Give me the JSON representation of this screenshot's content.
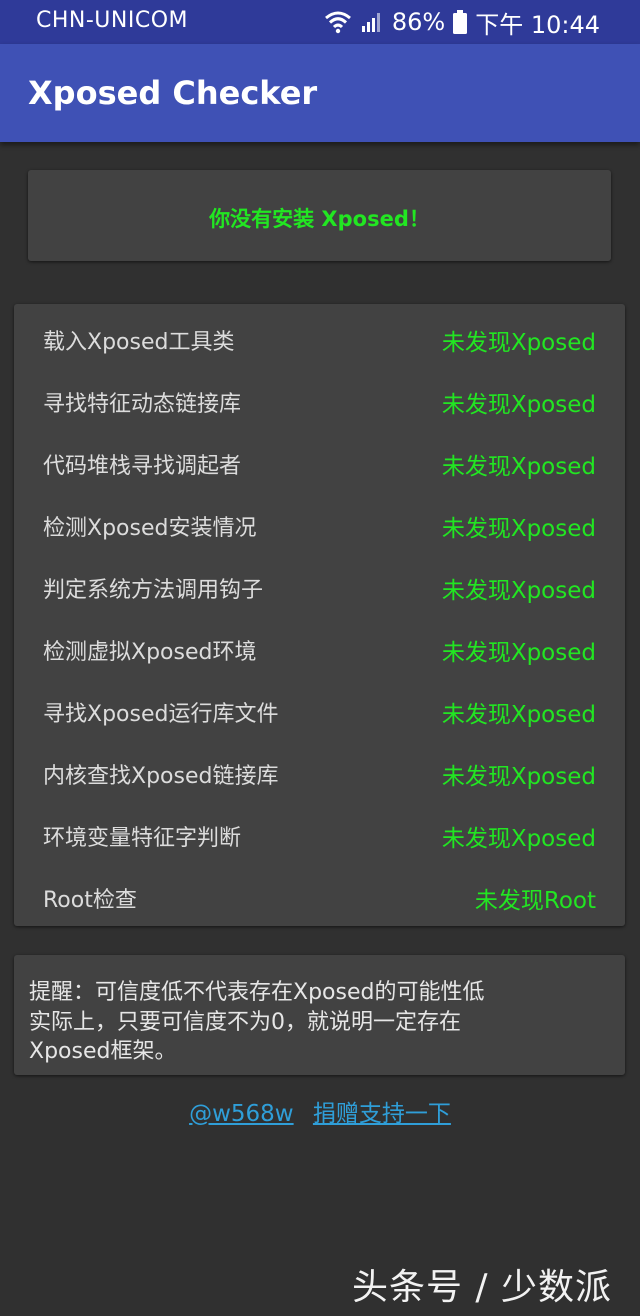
{
  "status_bar": {
    "carrier": "CHN-UNICOM",
    "battery": "86%",
    "time": "下午 10:44",
    "icons": [
      "wifi-icon",
      "signal-icon",
      "battery-icon"
    ]
  },
  "app_bar": {
    "title": "Xposed Checker"
  },
  "banner": {
    "message": "你没有安装 Xposed！"
  },
  "checks": [
    {
      "label": "载入Xposed工具类",
      "result": "未发现Xposed"
    },
    {
      "label": "寻找特征动态链接库",
      "result": "未发现Xposed"
    },
    {
      "label": "代码堆栈寻找调起者",
      "result": "未发现Xposed"
    },
    {
      "label": "检测Xposed安装情况",
      "result": "未发现Xposed"
    },
    {
      "label": "判定系统方法调用钩子",
      "result": "未发现Xposed"
    },
    {
      "label": "检测虚拟Xposed环境",
      "result": "未发现Xposed"
    },
    {
      "label": "寻找Xposed运行库文件",
      "result": "未发现Xposed"
    },
    {
      "label": "内核查找Xposed链接库",
      "result": "未发现Xposed"
    },
    {
      "label": "环境变量特征字判断",
      "result": "未发现Xposed"
    },
    {
      "label": "Root检查",
      "result": "未发现Root"
    }
  ],
  "note": {
    "line1": "提醒：可信度低不代表存在Xposed的可能性低",
    "line2": "实际上，只要可信度不为0，就说明一定存在",
    "line3": "Xposed框架。"
  },
  "links": {
    "author": "@w568w",
    "donate": "捐赠支持一下"
  },
  "watermark": "头条号 / 少数派",
  "colors": {
    "app_bar": "#3f51b5",
    "status_bar": "#2f3a99",
    "background": "#303030",
    "card": "#424242",
    "success_green": "#22e622",
    "link_blue": "#2f9ed8"
  }
}
